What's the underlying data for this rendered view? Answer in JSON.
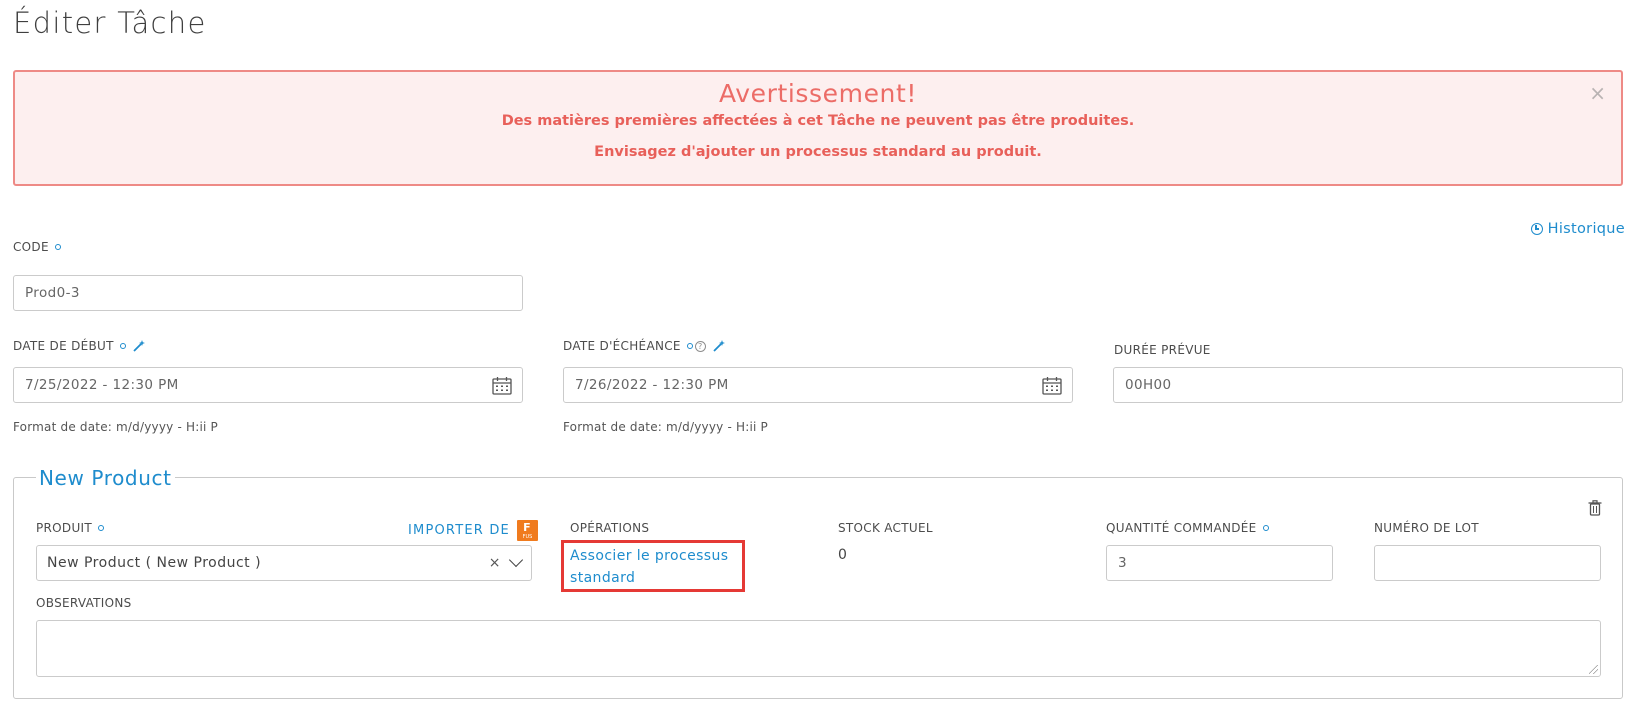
{
  "page": {
    "title": "Éditer Tâche"
  },
  "alert": {
    "title": "Avertissement!",
    "line1": "Des matières premières affectées à cet Tâche ne peuvent pas être produites.",
    "line2": "Envisagez d'ajouter un processus standard au produit.",
    "close": "×"
  },
  "history": {
    "label": "Historique",
    "icon": "clock-icon"
  },
  "fields": {
    "code": {
      "label": "CODE",
      "value": "Prod0-3"
    },
    "start_date": {
      "label": "DATE DE DÉBUT",
      "value": "7/25/2022 - 12:30 PM",
      "hint": "Format de date: m/d/yyyy - H:ii P"
    },
    "due_date": {
      "label": "DATE D'ÉCHÉANCE",
      "help": "?",
      "value": "7/26/2022 - 12:30 PM",
      "hint": "Format de date: m/d/yyyy - H:ii P"
    },
    "duration": {
      "label": "DURÉE PRÉVUE",
      "value": "00H00"
    }
  },
  "product_section": {
    "legend": "New Product",
    "product_label": "PRODUIT",
    "importer_label": "IMPORTER DE",
    "importer_badge": {
      "letter": "F",
      "sub": "FUS"
    },
    "product_value": "New Product ( New Product )",
    "clear": "×",
    "operations_label": "OPÉRATIONS",
    "associate_link": "Associer le processus standard",
    "stock_label": "STOCK ACTUEL",
    "stock_value": "0",
    "quantity_label": "QUANTITÉ COMMANDÉE",
    "quantity_value": "3",
    "lot_label": "NUMÉRO DE LOT",
    "lot_value": "",
    "observations_label": "OBSERVATIONS"
  },
  "colors": {
    "accent": "#1e8ccd",
    "alert_border": "#ee8a86",
    "alert_bg": "#fdefef",
    "alert_text": "#e8605a",
    "highlight": "#e53935",
    "badge": "#f07b1e"
  }
}
